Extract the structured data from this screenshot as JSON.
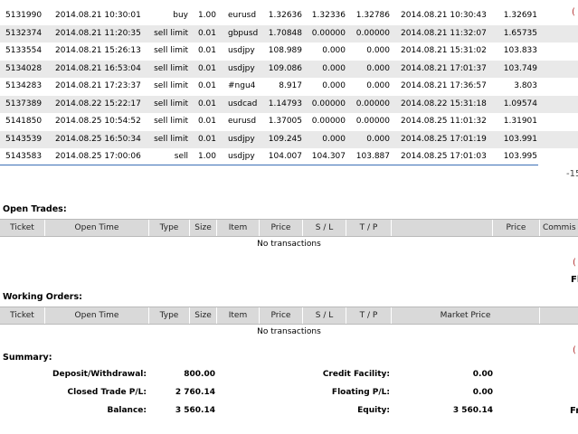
{
  "closed_trades": [
    {
      "ticket": "5131990",
      "open_time": "2014.08.21 10:30:01",
      "type": "buy",
      "size": "1.00",
      "item": "eurusd",
      "price": "1.32636",
      "sl": "1.32336",
      "tp": "1.32786",
      "close_time": "2014.08.21 10:30:43",
      "close_price": "1.32691"
    },
    {
      "ticket": "5132374",
      "open_time": "2014.08.21 11:20:35",
      "type": "sell limit",
      "size": "0.01",
      "item": "gbpusd",
      "price": "1.70848",
      "sl": "0.00000",
      "tp": "0.00000",
      "close_time": "2014.08.21 11:32:07",
      "close_price": "1.65735"
    },
    {
      "ticket": "5133554",
      "open_time": "2014.08.21 15:26:13",
      "type": "sell limit",
      "size": "0.01",
      "item": "usdjpy",
      "price": "108.989",
      "sl": "0.000",
      "tp": "0.000",
      "close_time": "2014.08.21 15:31:02",
      "close_price": "103.833"
    },
    {
      "ticket": "5134028",
      "open_time": "2014.08.21 16:53:04",
      "type": "sell limit",
      "size": "0.01",
      "item": "usdjpy",
      "price": "109.086",
      "sl": "0.000",
      "tp": "0.000",
      "close_time": "2014.08.21 17:01:37",
      "close_price": "103.749"
    },
    {
      "ticket": "5134283",
      "open_time": "2014.08.21 17:23:37",
      "type": "sell limit",
      "size": "0.01",
      "item": "#ngu4",
      "price": "8.917",
      "sl": "0.000",
      "tp": "0.000",
      "close_time": "2014.08.21 17:36:57",
      "close_price": "3.803"
    },
    {
      "ticket": "5137389",
      "open_time": "2014.08.22 15:22:17",
      "type": "sell limit",
      "size": "0.01",
      "item": "usdcad",
      "price": "1.14793",
      "sl": "0.00000",
      "tp": "0.00000",
      "close_time": "2014.08.22 15:31:18",
      "close_price": "1.09574"
    },
    {
      "ticket": "5141850",
      "open_time": "2014.08.25 10:54:52",
      "type": "sell limit",
      "size": "0.01",
      "item": "eurusd",
      "price": "1.37005",
      "sl": "0.00000",
      "tp": "0.00000",
      "close_time": "2014.08.25 11:01:32",
      "close_price": "1.31901"
    },
    {
      "ticket": "5143539",
      "open_time": "2014.08.25 16:50:34",
      "type": "sell limit",
      "size": "0.01",
      "item": "usdjpy",
      "price": "109.245",
      "sl": "0.000",
      "tp": "0.000",
      "close_time": "2014.08.25 17:01:19",
      "close_price": "103.991"
    },
    {
      "ticket": "5143583",
      "open_time": "2014.08.25 17:00:06",
      "type": "sell",
      "size": "1.00",
      "item": "usdjpy",
      "price": "104.007",
      "sl": "104.307",
      "tp": "103.887",
      "close_time": "2014.08.25 17:01:03",
      "close_price": "103.995"
    }
  ],
  "edge_glyphs": {
    "closed_pl_total_partial": "-15",
    "open_trades_right_partial": "(",
    "open_trades_right_partial2": "Fl",
    "working_orders_right_partial": "(",
    "summary_right_partial": "Fr"
  },
  "open_trades": {
    "title": "Open Trades:",
    "headers": {
      "ticket": "Ticket",
      "open_time": "Open Time",
      "type": "Type",
      "size": "Size",
      "item": "Item",
      "price": "Price",
      "sl": "S / L",
      "tp": "T / P",
      "price2": "Price",
      "commission": "Commis"
    },
    "empty_text": "No transactions"
  },
  "working_orders": {
    "title": "Working Orders:",
    "headers": {
      "ticket": "Ticket",
      "open_time": "Open Time",
      "type": "Type",
      "size": "Size",
      "item": "Item",
      "price": "Price",
      "sl": "S / L",
      "tp": "T / P",
      "market_price": "Market Price"
    },
    "empty_text": "No transactions"
  },
  "summary": {
    "title": "Summary:",
    "deposit_label": "Deposit/Withdrawal:",
    "deposit_value": "800.00",
    "closed_pl_label": "Closed Trade P/L:",
    "closed_pl_value": "2 760.14",
    "balance_label": "Balance:",
    "balance_value": "3 560.14",
    "credit_label": "Credit Facility:",
    "credit_value": "0.00",
    "floating_label": "Floating P/L:",
    "floating_value": "0.00",
    "equity_label": "Equity:",
    "equity_value": "3 560.14"
  }
}
